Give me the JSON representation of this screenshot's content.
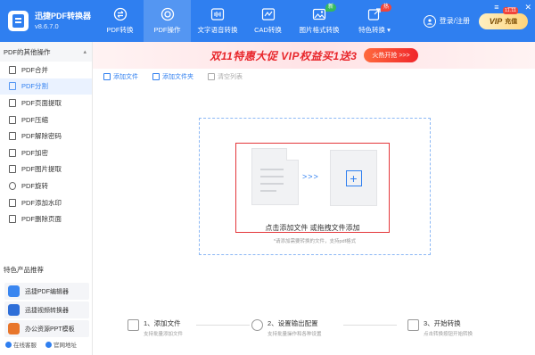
{
  "app": {
    "name": "迅捷PDF转换器",
    "version": "v8.6.7.0"
  },
  "nav": [
    {
      "label": "PDF转换",
      "icon": "swap-icon"
    },
    {
      "label": "PDF操作",
      "icon": "target-icon",
      "active": true
    },
    {
      "label": "文字语音转换",
      "icon": "audio-wave-icon"
    },
    {
      "label": "CAD转换",
      "icon": "cad-icon"
    },
    {
      "label": "图片格式转换",
      "icon": "image-icon",
      "badge": "新"
    },
    {
      "label": "特色转换",
      "icon": "share-icon",
      "badge": "热"
    }
  ],
  "header": {
    "login_label": "登录/注册",
    "vip_label": "VIP",
    "vip_action": "充值",
    "vip_tag": "11.11"
  },
  "sidebar": {
    "title": "PDF的其他操作",
    "items": [
      {
        "label": "PDF合并"
      },
      {
        "label": "PDF分割",
        "active": true
      },
      {
        "label": "PDF页面提取"
      },
      {
        "label": "PDF压缩"
      },
      {
        "label": "PDF解除密码"
      },
      {
        "label": "PDF加密"
      },
      {
        "label": "PDF图片提取"
      },
      {
        "label": "PDF旋转"
      },
      {
        "label": "PDF添加水印"
      },
      {
        "label": "PDF删除页面"
      }
    ],
    "featured_title": "特色产品推荐",
    "featured": [
      {
        "label": "迅捷PDF编辑器",
        "color": "#3a86f0"
      },
      {
        "label": "迅捷视频转换器",
        "color": "#2f6fd8"
      },
      {
        "label": "办公资源PPT模板",
        "color": "#e8762b"
      }
    ],
    "bottom": {
      "service": "在线客服",
      "website": "官网地址"
    }
  },
  "banner": {
    "text": "双11特惠大促  VIP权益买1送3",
    "button": "火热开抢 >>>"
  },
  "toolbar": {
    "add_file": "添加文件",
    "add_folder": "添加文件夹",
    "clear_list": "清空列表"
  },
  "dropzone": {
    "text": "点击添加文件 或拖拽文件添加",
    "hint": "*请添加需要转换的文件，支持pdf格式",
    "arrows": ">>>",
    "plus": "+"
  },
  "steps": [
    {
      "title": "1、添加文件",
      "sub": "支持批量添加文件"
    },
    {
      "title": "2、设置输出配置",
      "sub": "支持批量操作和各种设置"
    },
    {
      "title": "3、开始转换",
      "sub": "点击转换按钮开始转换"
    }
  ],
  "colors": {
    "primary": "#2f7ff0",
    "highlight_frame": "#e4363a"
  }
}
